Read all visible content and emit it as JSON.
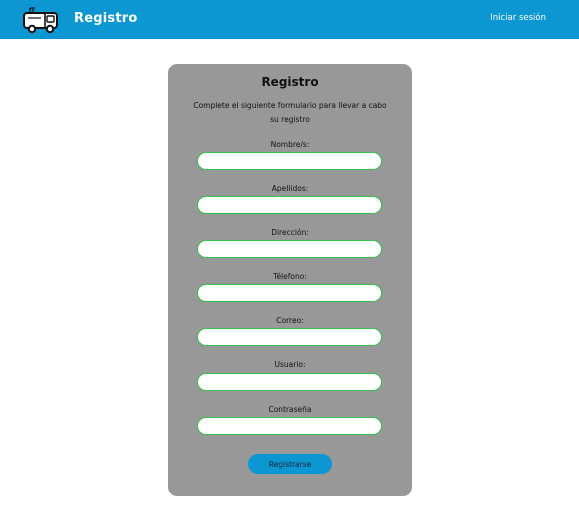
{
  "header": {
    "logo_icon": "truck-icon",
    "brand": "Registro",
    "login_link": "Iniciar sesión",
    "background_color": "#0d97d2"
  },
  "form": {
    "title": "Registro",
    "description": "Complete el siguiente formulario para llevar a cabo  su registro",
    "fields": [
      {
        "label": "Nombre/s:",
        "value": ""
      },
      {
        "label": "Apellidos:",
        "value": ""
      },
      {
        "label": "Dirección:",
        "value": ""
      },
      {
        "label": "Télefono:",
        "value": ""
      },
      {
        "label": "Correo:",
        "value": ""
      },
      {
        "label": "Usuario:",
        "value": ""
      },
      {
        "label": "Contraseña",
        "value": ""
      }
    ],
    "submit_label": "Registrarse",
    "card_color": "#989898",
    "input_border_color": "#34c24a"
  }
}
